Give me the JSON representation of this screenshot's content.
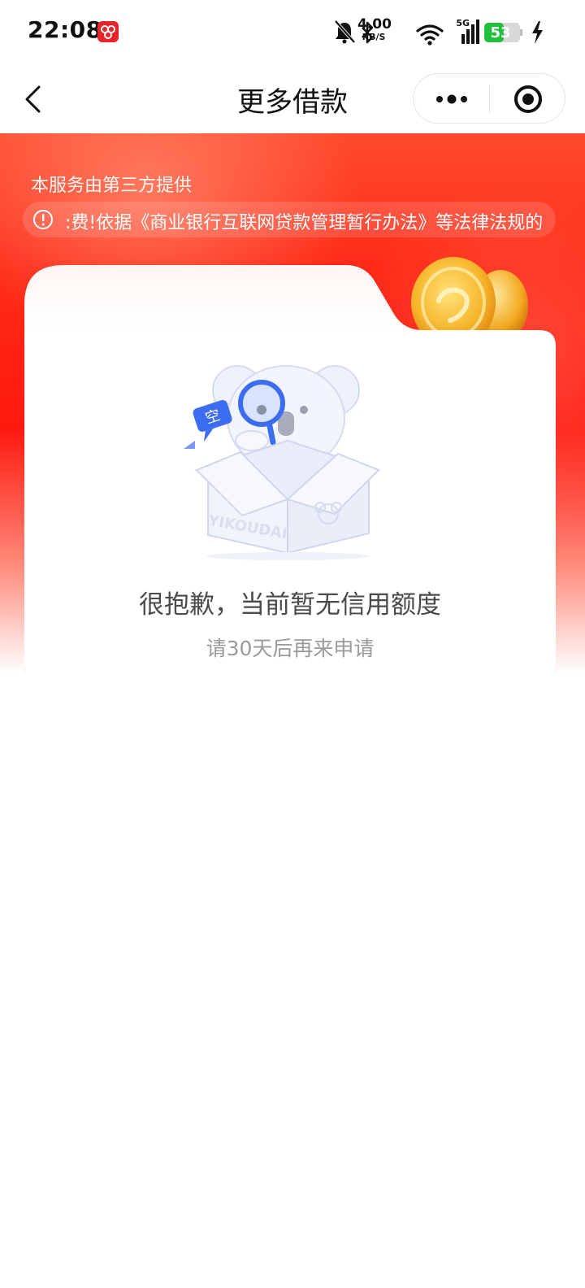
{
  "status_bar": {
    "time": "22:08",
    "network_speed_value": "4.00",
    "network_speed_unit": "KB/S",
    "cell_label": "5G",
    "battery": "53",
    "battery_color": "#22c03a"
  },
  "nav": {
    "title": "更多借款",
    "back_icon": "chevron-left-icon",
    "more_icon": "more-dots-icon",
    "close_icon": "target-circle-icon"
  },
  "hero": {
    "provider_note": "本服务由第三方提供",
    "notice_text": ":费!依据《商业银行互联网贷款管理暂行办法》等法律法规的",
    "brand_red": "#ff1a10"
  },
  "card": {
    "illustration_text": "YIKOUDAI",
    "bubble_text": "空",
    "title": "很抱歉，当前暂无信用额度",
    "subtitle": "请30天后再来申请"
  }
}
